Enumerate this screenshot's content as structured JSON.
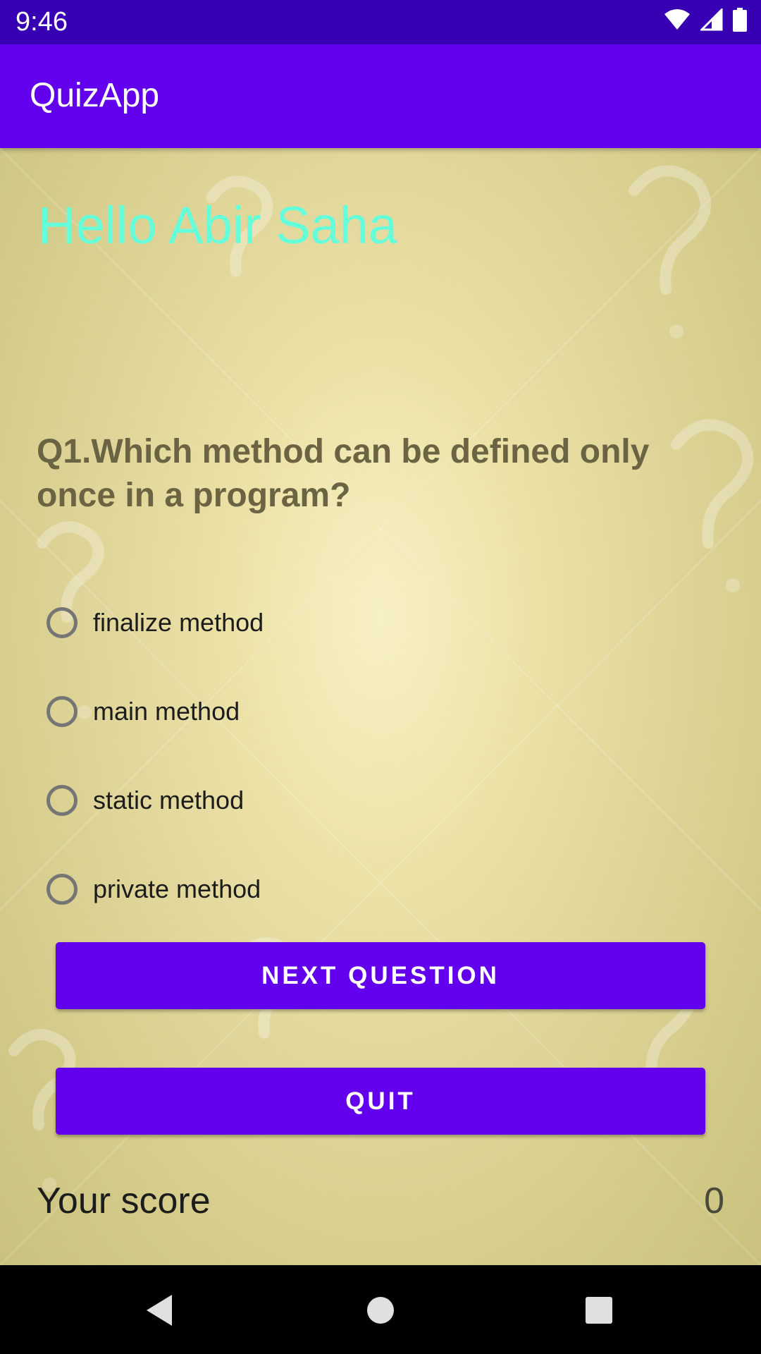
{
  "status_bar": {
    "time": "9:46",
    "icons": [
      "wifi-icon",
      "signal-icon",
      "battery-icon"
    ]
  },
  "app_bar": {
    "title": "QuizApp"
  },
  "greeting": "Hello Abir Saha",
  "question": {
    "text": "Q1.Which method can be defined only once in a program?",
    "options": [
      {
        "label": "finalize method",
        "selected": false
      },
      {
        "label": "main method",
        "selected": false
      },
      {
        "label": "static method",
        "selected": false
      },
      {
        "label": "private method",
        "selected": false
      }
    ]
  },
  "buttons": {
    "next_label": "NEXT QUESTION",
    "quit_label": "QUIT"
  },
  "score": {
    "label": "Your score",
    "value": "0"
  },
  "nav_bar": {
    "icons": [
      "back-icon",
      "home-icon",
      "recents-icon"
    ]
  },
  "colors": {
    "status_bar": "#3700b3",
    "app_bar": "#6200ee",
    "accent": "#6200ee",
    "greeting": "#64ffda",
    "question_text": "#6a6442"
  }
}
